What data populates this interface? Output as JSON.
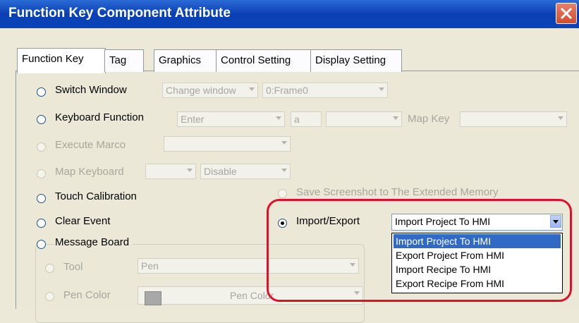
{
  "window": {
    "title": "Function Key Component Attribute"
  },
  "tabs": [
    {
      "label": "Function Key"
    },
    {
      "label": "Tag"
    },
    {
      "label": "Graphics"
    },
    {
      "label": "Control Setting"
    },
    {
      "label": "Display Setting"
    }
  ],
  "options": {
    "switch_window": {
      "label": "Switch Window",
      "window_combo": "Change window",
      "frame_combo": "0:Frame0"
    },
    "keyboard_function": {
      "label": "Keyboard Function",
      "key_combo": "Enter",
      "char_field": "a",
      "map_key_label": "Map Key"
    },
    "execute_marco": {
      "label": "Execute Marco"
    },
    "map_keyboard": {
      "label": "Map Keyboard",
      "mode_combo": "Disable"
    },
    "touch_calibration": {
      "label": "Touch Calibration"
    },
    "save_screenshot": {
      "label": "Save Screenshot to The Extended Memory"
    },
    "clear_event": {
      "label": "Clear Event"
    },
    "import_export": {
      "label": "Import/Export",
      "selected": "Import Project To HMI"
    },
    "message_board": {
      "label": "Message Board",
      "tool_label": "Tool",
      "tool_combo": "Pen",
      "pen_color_label": "Pen Color",
      "pen_color_combo": "Pen Color"
    }
  },
  "dropdown": {
    "items": [
      "Import Project To HMI",
      "Export Project From HMI",
      "Import Recipe To HMI",
      "Export Recipe From HMI"
    ],
    "selected_index": 0
  },
  "colors": {
    "title_bar": "#0a3fb3",
    "selection": "#316ac5",
    "highlight_ring": "#e0102a"
  }
}
